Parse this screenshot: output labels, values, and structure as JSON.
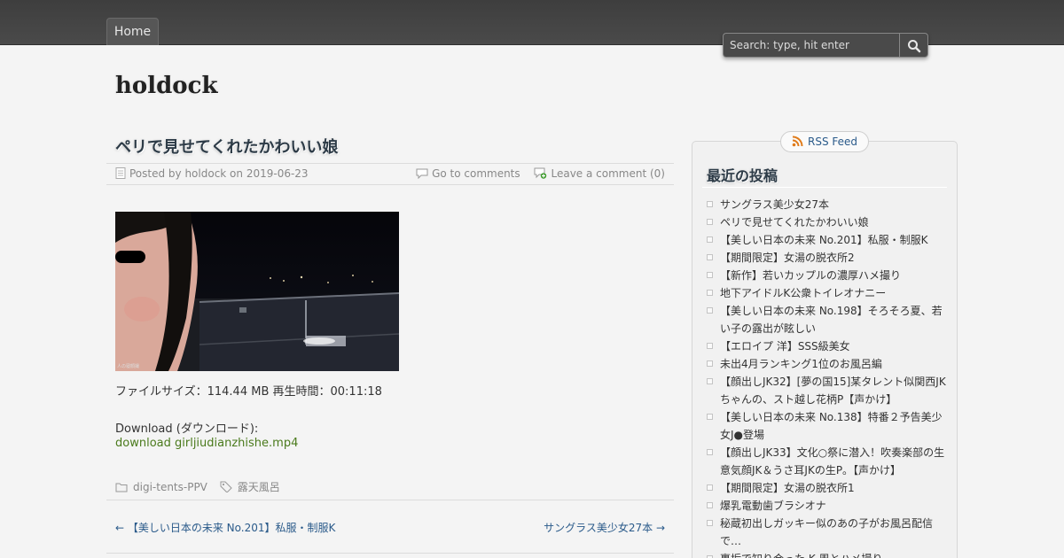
{
  "nav": {
    "home_label": "Home"
  },
  "search": {
    "placeholder": "Search: type, hit enter"
  },
  "site": {
    "title": "holdock"
  },
  "post": {
    "title": "ペリで見せてくれたかわいい娘",
    "meta": {
      "posted_by": "Posted by holdock on 2019-06-23",
      "comments_link": "Go to comments",
      "leave_comment": "Leave a comment (0)"
    },
    "image_caption": "人の寝顔撮",
    "file_info": "ファイルサイズ：114.44 MB 再生時間：00:11:18",
    "download_label": "Download (ダウンロード):",
    "download_link": "download girljiudianzhishe.mp4",
    "category": "digi-tents-PPV",
    "tag": "露天風呂"
  },
  "post_nav": {
    "prev": "← 【美しい日本の未来 No.201】私服・制服K",
    "next": "サングラス美少女27本 →"
  },
  "sidebar": {
    "rss_label": "RSS Feed",
    "widget_title": "最近の投稿",
    "recent_posts": [
      "サングラス美少女27本",
      "ペリで見せてくれたかわいい娘",
      "【美しい日本の未来 No.201】私服・制服K",
      "【期間限定】女湯の脱衣所2",
      "【新作】若いカップルの濃厚ハメ撮り",
      "地下アイドルK公衆トイレオナニー",
      "【美しい日本の未来 No.198】そろそろ夏、若い子の露出が眩しい",
      "【エロイプ 洋】SSS級美女",
      "未出4月ランキング1位のお風呂編",
      "【顔出しJK32】[夢の国15]某タレント似関西JKちゃんの、スト越し花柄P【声かけ】",
      "【美しい日本の未来 No.138】特番２予告美少女J●登場",
      "【顔出しJK33】文化○祭に潜入！吹奏楽部の生意気顔JK＆うさ耳JKの生P。【声かけ】",
      "【期間限定】女湯の脱衣所1",
      "爆乳電動歯ブラシオナ",
      "秘蔵初出しガッキー似のあの子がお風呂配信で…",
      "裏垢で知り合った K 周とハメ撮り"
    ]
  }
}
